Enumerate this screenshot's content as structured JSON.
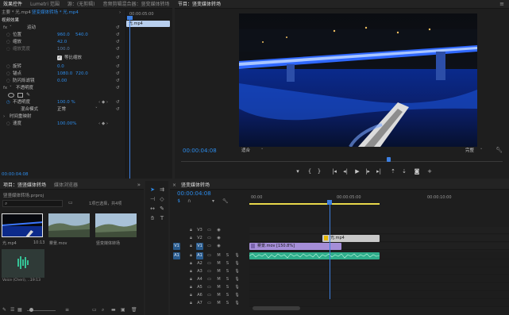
{
  "effect_controls": {
    "tabs": [
      "效果控件",
      "Lumetri 范围",
      "源：(无剪辑)",
      "音频剪辑混合器：竖变媒体转场"
    ],
    "sub_source": "主要 * 光.mp4",
    "sub_clip": "竖变媒体转场 * 光.mp4",
    "timecode_top": "00:00:05:00",
    "mini_clip": "光.mp4",
    "section_video": "视频效果",
    "fx_motion": "运动",
    "rows": [
      {
        "label": "位置",
        "value1": "960.0",
        "value2": "540.0"
      },
      {
        "label": "缩放",
        "value1": "42.0",
        "value2": ""
      },
      {
        "label": "缩放宽度",
        "value1": "100.0",
        "value2": ""
      },
      {
        "label": "等比缩放",
        "value1": "",
        "value2": ""
      },
      {
        "label": "旋转",
        "value1": "0.0",
        "value2": ""
      },
      {
        "label": "锚点",
        "value1": "1080.0",
        "value2": "720.0"
      },
      {
        "label": "防闪烁滤镜",
        "value1": "0.00",
        "value2": ""
      }
    ],
    "fx_opacity": "不透明度",
    "opacity_label": "不透明度",
    "opacity_value": "100.0 %",
    "blend_label": "混合模式",
    "blend_value": "正常",
    "fx_time": "时间重映射",
    "speed_label": "速度",
    "speed_value": "100.00%",
    "bottom_timecode": "00:00:04:08"
  },
  "program": {
    "title": "节目：竖变媒体转场",
    "timecode": "00:00:04:08",
    "fit": "适合",
    "quality": "完整",
    "playhead_fraction": 0.64
  },
  "project": {
    "tabs": [
      "项目：竖竖媒体转场",
      "媒体浏览器"
    ],
    "file": "竖竖媒体转场.prproj",
    "count": "1项已选择，共4项",
    "items": [
      {
        "name": "光.mp4",
        "duration": "10:13",
        "kind": "night"
      },
      {
        "name": "雾景.mov",
        "duration": "",
        "kind": "land"
      },
      {
        "name": "竖变媒体转场",
        "duration": "",
        "kind": "land2"
      }
    ],
    "audio_item": "Voice (Cheri), ...",
    "audio_dur": "19:13"
  },
  "timeline": {
    "title": "竖变媒体转场",
    "timecode": "00:00:04:08",
    "ruler": [
      "00:00",
      "00:00:05:00",
      "00:00:10:00"
    ],
    "tracks": [
      {
        "id": "V3",
        "kind": "v"
      },
      {
        "id": "V2",
        "kind": "v"
      },
      {
        "id": "V1",
        "kind": "v"
      },
      {
        "id": "A1",
        "kind": "a"
      },
      {
        "id": "A2",
        "kind": "a"
      },
      {
        "id": "A3",
        "kind": "a"
      },
      {
        "id": "A4",
        "kind": "a"
      },
      {
        "id": "A5",
        "kind": "a"
      },
      {
        "id": "A6",
        "kind": "a"
      },
      {
        "id": "A7",
        "kind": "a"
      }
    ],
    "source_patch": [
      "V1",
      "A1"
    ],
    "clip_v2": "光.mp4",
    "clip_v1": "雾景.mov [150.8%]"
  },
  "colors": {
    "accent": "#2d8ceb",
    "v1_clip": "#a58ed8",
    "a1_clip": "#2fae8c",
    "v2_clip": "#c8c8c8",
    "playhead": "#3d7fe0"
  }
}
